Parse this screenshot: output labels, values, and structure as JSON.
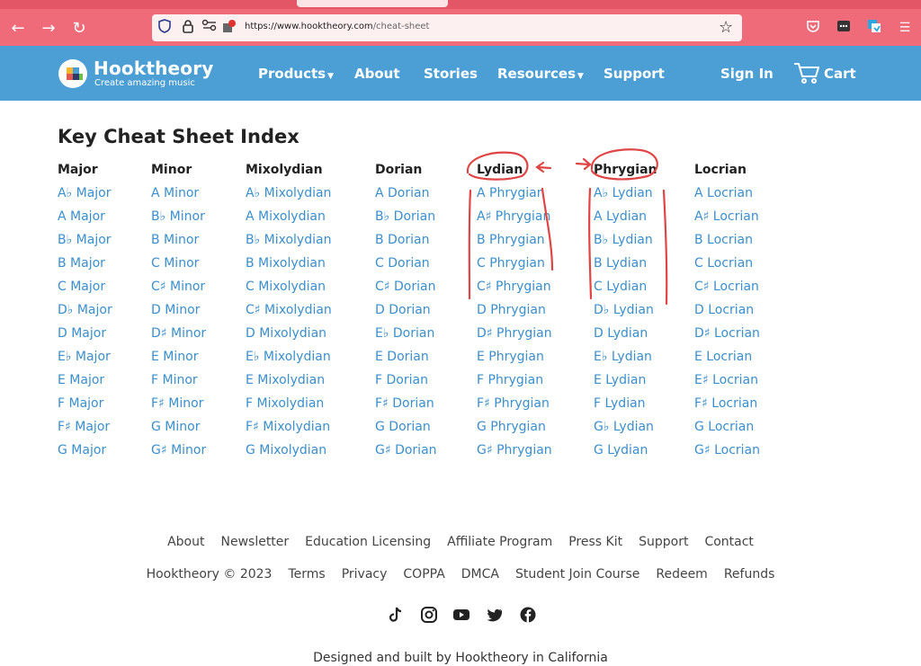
{
  "browser": {
    "url_host": "https://www.hooktheory.com",
    "url_path": "/cheat-sheet"
  },
  "header": {
    "logo_name": "Hooktheory",
    "logo_tagline": "Create amazing music",
    "nav": [
      "Products",
      "About",
      "Stories",
      "Resources",
      "Support"
    ],
    "sign_in": "Sign In",
    "cart": "Cart"
  },
  "main": {
    "title": "Key Cheat Sheet Index",
    "columns": [
      {
        "heading": "Major",
        "items": [
          "A♭ Major",
          "A Major",
          "B♭ Major",
          "B Major",
          "C Major",
          "D♭ Major",
          "D Major",
          "E♭ Major",
          "E Major",
          "F Major",
          "F♯ Major",
          "G Major"
        ]
      },
      {
        "heading": "Minor",
        "items": [
          "A Minor",
          "B♭ Minor",
          "B Minor",
          "C Minor",
          "C♯ Minor",
          "D Minor",
          "D♯ Minor",
          "E Minor",
          "F Minor",
          "F♯ Minor",
          "G Minor",
          "G♯ Minor"
        ]
      },
      {
        "heading": "Mixolydian",
        "items": [
          "A♭ Mixolydian",
          "A Mixolydian",
          "B♭ Mixolydian",
          "B Mixolydian",
          "C Mixolydian",
          "C♯ Mixolydian",
          "D Mixolydian",
          "E♭ Mixolydian",
          "E Mixolydian",
          "F Mixolydian",
          "F♯ Mixolydian",
          "G Mixolydian"
        ]
      },
      {
        "heading": "Dorian",
        "items": [
          "A Dorian",
          "B♭ Dorian",
          "B Dorian",
          "C Dorian",
          "C♯ Dorian",
          "D Dorian",
          "E♭ Dorian",
          "E Dorian",
          "F Dorian",
          "F♯ Dorian",
          "G Dorian",
          "G♯ Dorian"
        ]
      },
      {
        "heading": "Lydian",
        "items": [
          "A Phrygian",
          "A♯ Phrygian",
          "B Phrygian",
          "C Phrygian",
          "C♯ Phrygian",
          "D Phrygian",
          "D♯ Phrygian",
          "E Phrygian",
          "F Phrygian",
          "F♯ Phrygian",
          "G Phrygian",
          "G♯ Phrygian"
        ]
      },
      {
        "heading": "Phrygian",
        "items": [
          "A♭ Lydian",
          "A Lydian",
          "B♭ Lydian",
          "B Lydian",
          "C Lydian",
          "D♭ Lydian",
          "D Lydian",
          "E♭ Lydian",
          "E Lydian",
          "F Lydian",
          "G♭ Lydian",
          "G Lydian"
        ]
      },
      {
        "heading": "Locrian",
        "items": [
          "A Locrian",
          "A♯ Locrian",
          "B Locrian",
          "C Locrian",
          "C♯ Locrian",
          "D Locrian",
          "D♯ Locrian",
          "E Locrian",
          "E♯ Locrian",
          "F♯ Locrian",
          "G Locrian",
          "G♯ Locrian"
        ]
      }
    ]
  },
  "footer": {
    "row1": [
      "About",
      "Newsletter",
      "Education Licensing",
      "Affiliate Program",
      "Press Kit",
      "Support",
      "Contact"
    ],
    "row2": [
      "Hooktheory © 2023",
      "Terms",
      "Privacy",
      "COPPA",
      "DMCA",
      "Student Join Course",
      "Redeem",
      "Refunds"
    ],
    "social_icons": [
      "tiktok-icon",
      "instagram-icon",
      "youtube-icon",
      "twitter-icon",
      "facebook-icon"
    ],
    "credit": "Designed and built by Hooktheory in California"
  },
  "colors": {
    "browser_bar": "#f06b7a",
    "header": "#4b9fd4",
    "link": "#3a8fcc",
    "annotation": "#e04545"
  }
}
